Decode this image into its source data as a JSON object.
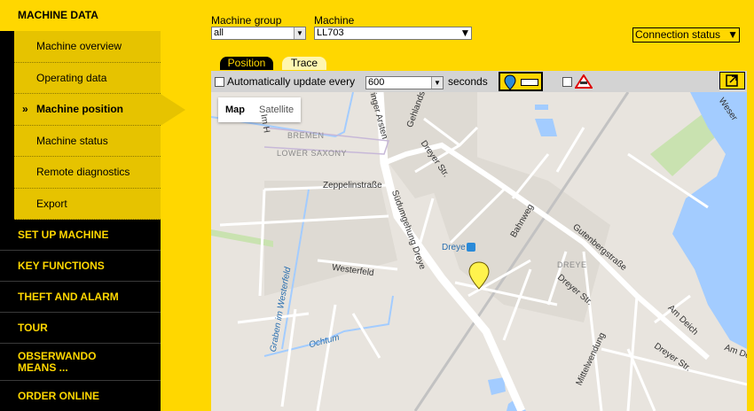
{
  "sidebar": {
    "section_machine_data": "MACHINE DATA",
    "sub_items": [
      {
        "label": "Machine overview"
      },
      {
        "label": "Operating data"
      },
      {
        "label": "Machine position",
        "prefix": "»"
      },
      {
        "label": "Machine status"
      },
      {
        "label": "Remote diagnostics"
      },
      {
        "label": "Export"
      }
    ],
    "sections": [
      "SET UP MACHINE",
      "KEY FUNCTIONS",
      "THEFT AND ALARM",
      "TOUR",
      "OBSERWANDO MEANS ...",
      "ORDER ONLINE"
    ]
  },
  "filters": {
    "machine_group_label": "Machine group",
    "machine_group_value": "all",
    "machine_label": "Machine",
    "machine_value": "LL703",
    "connection_status": "Connection status"
  },
  "tabs": {
    "position": "Position",
    "trace": "Trace"
  },
  "toolbar": {
    "auto_update_label": "Automatically update every",
    "interval_value": "600",
    "seconds_label": "seconds"
  },
  "map": {
    "type_map": "Map",
    "type_satellite": "Satellite",
    "labels": {
      "weser": "Weser",
      "bremen": "BREMEN",
      "lower_saxony": "LOWER SAXONY",
      "zeppelinstrasse": "Zeppelinstraße",
      "westerfeld": "Westerfeld",
      "dreye": "Dreye",
      "dreye_area": "DREYE",
      "bahnweg": "Bahnweg",
      "gutenbergstrasse": "Gutenbergstraße",
      "dreyer_str_1": "Dreyer Str.",
      "dreyer_str_2": "Dreyer Str.",
      "dreyer_str_3": "Dreyer Str.",
      "am_deich_1": "Am Deich",
      "am_deich_2": "Am De",
      "mittelwendung": "Mittelwendung",
      "graben": "Graben im Westerfeld",
      "ochtum": "Ochtum",
      "sudumgehung": "Südumgehung Dreye",
      "arsten": "ringer Arsten",
      "gehlands": "Gehlands",
      "im_h": "Im H"
    }
  },
  "colors": {
    "brand_yellow": "#ffd700",
    "sidebar_black": "#000000",
    "sub_item_bg": "#e6c300"
  }
}
